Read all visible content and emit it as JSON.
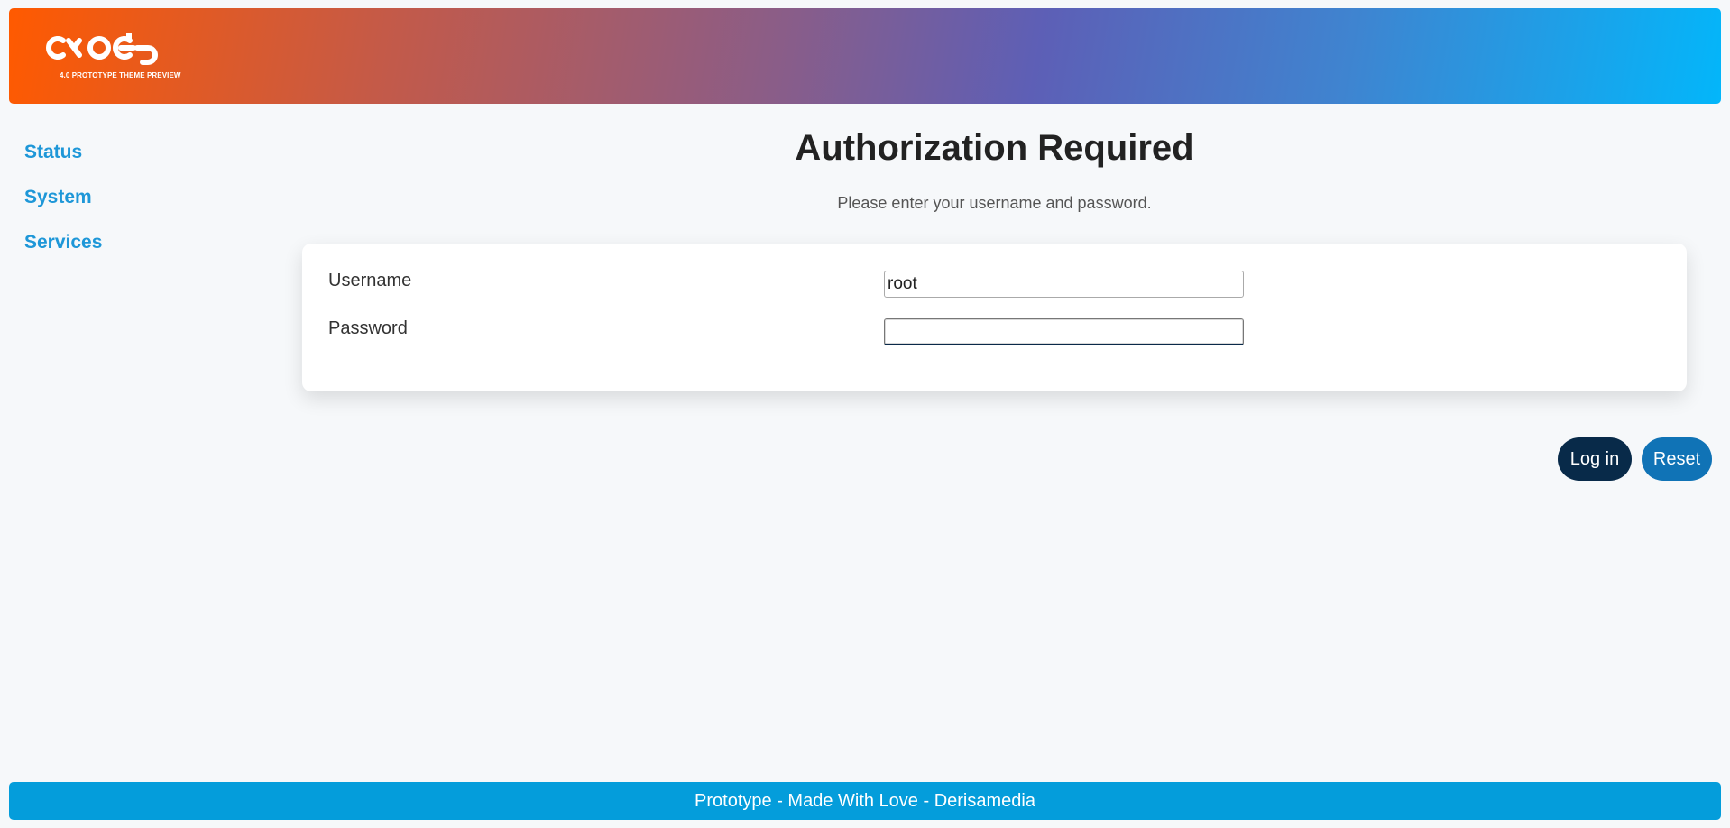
{
  "header": {
    "logo_subtitle": "4.0 PROTOTYPE THEME PREVIEW",
    "gradient": [
      "#ff5a00",
      "#5d5fb6",
      "#03b6fa"
    ]
  },
  "sidebar": {
    "items": [
      {
        "label": "Status"
      },
      {
        "label": "System"
      },
      {
        "label": "Services"
      }
    ],
    "color": "#1e97d8"
  },
  "main": {
    "title": "Authorization Required",
    "subtitle": "Please enter your username and password.",
    "form": {
      "username_label": "Username",
      "username_value": "root",
      "password_label": "Password",
      "password_value": ""
    },
    "buttons": {
      "login_label": "Log in",
      "reset_label": "Reset",
      "login_color": "#082a49",
      "reset_color": "#1073b6"
    }
  },
  "footer": {
    "text": "Prototype - Made With Love - Derisamedia",
    "color": "#049ddb"
  }
}
